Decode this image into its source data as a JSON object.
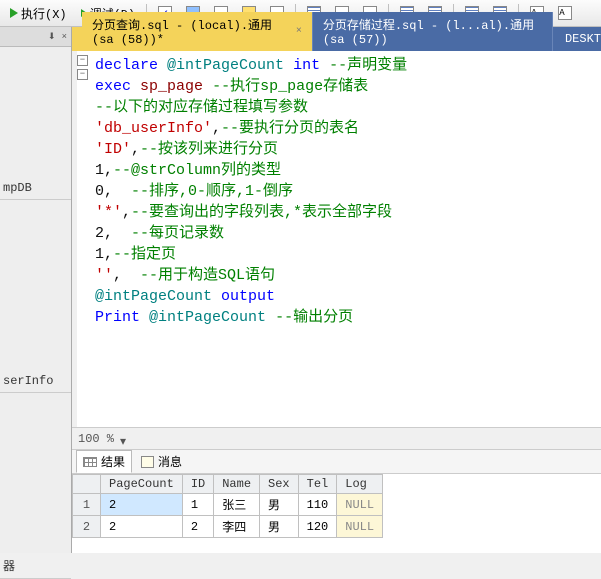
{
  "toolbar": {
    "run_label": "执行(X)",
    "debug_label": "调试(D)"
  },
  "tabs": {
    "active": "分页查询.sql - (local).通用 (sa (58))*",
    "inactive": "分页存储过程.sql - (l...al).通用 (sa (57))",
    "tail": "DESKT"
  },
  "left": {
    "pin": "⬇",
    "close": "×",
    "item1": "mpDB",
    "item2": "serInfo",
    "item3": "器"
  },
  "code": {
    "l1a": "declare",
    "l1b": "@intPageCount",
    "l1c": "int",
    "l1d": "--声明变量",
    "l2a": "exec",
    "l2b": "sp_page",
    "l2c": "--执行sp_page存储表",
    "l3": "--以下的对应存储过程填写参数",
    "l4a": "'db_userInfo'",
    "l4b": ",",
    "l4c": "--要执行分页的表名",
    "l5a": "'ID'",
    "l5b": ",",
    "l5c": "--按该列来进行分页",
    "l6a": "1",
    "l6b": ",",
    "l6c": "--@strColumn列的类型",
    "l7a": "0",
    "l7b": ",  ",
    "l7c": "--排序,0-顺序,1-倒序",
    "l8a": "'*'",
    "l8b": ",",
    "l8c": "--要查询出的字段列表,*表示全部字段",
    "l9a": "2",
    "l9b": ",  ",
    "l9c": "--每页记录数",
    "l10a": "1",
    "l10b": ",",
    "l10c": "--指定页",
    "l11a": "''",
    "l11b": ",  ",
    "l11c": "--用于构造SQL语句",
    "l12a": "@intPageCount",
    "l12b": "output",
    "l13a": "Print",
    "l13b": "@intPageCount",
    "l13c": "--输出分页"
  },
  "zoom": "100 %",
  "results_tabs": {
    "results": "结果",
    "messages": "消息"
  },
  "grid": {
    "columns": [
      "",
      "PageCount",
      "ID",
      "Name",
      "Sex",
      "Tel",
      "Log"
    ],
    "rows": [
      {
        "n": "1",
        "PageCount": "2",
        "ID": "1",
        "Name": "张三",
        "Sex": "男",
        "Tel": "110",
        "Log": "NULL"
      },
      {
        "n": "2",
        "PageCount": "2",
        "ID": "2",
        "Name": "李四",
        "Sex": "男",
        "Tel": "120",
        "Log": "NULL"
      }
    ]
  }
}
